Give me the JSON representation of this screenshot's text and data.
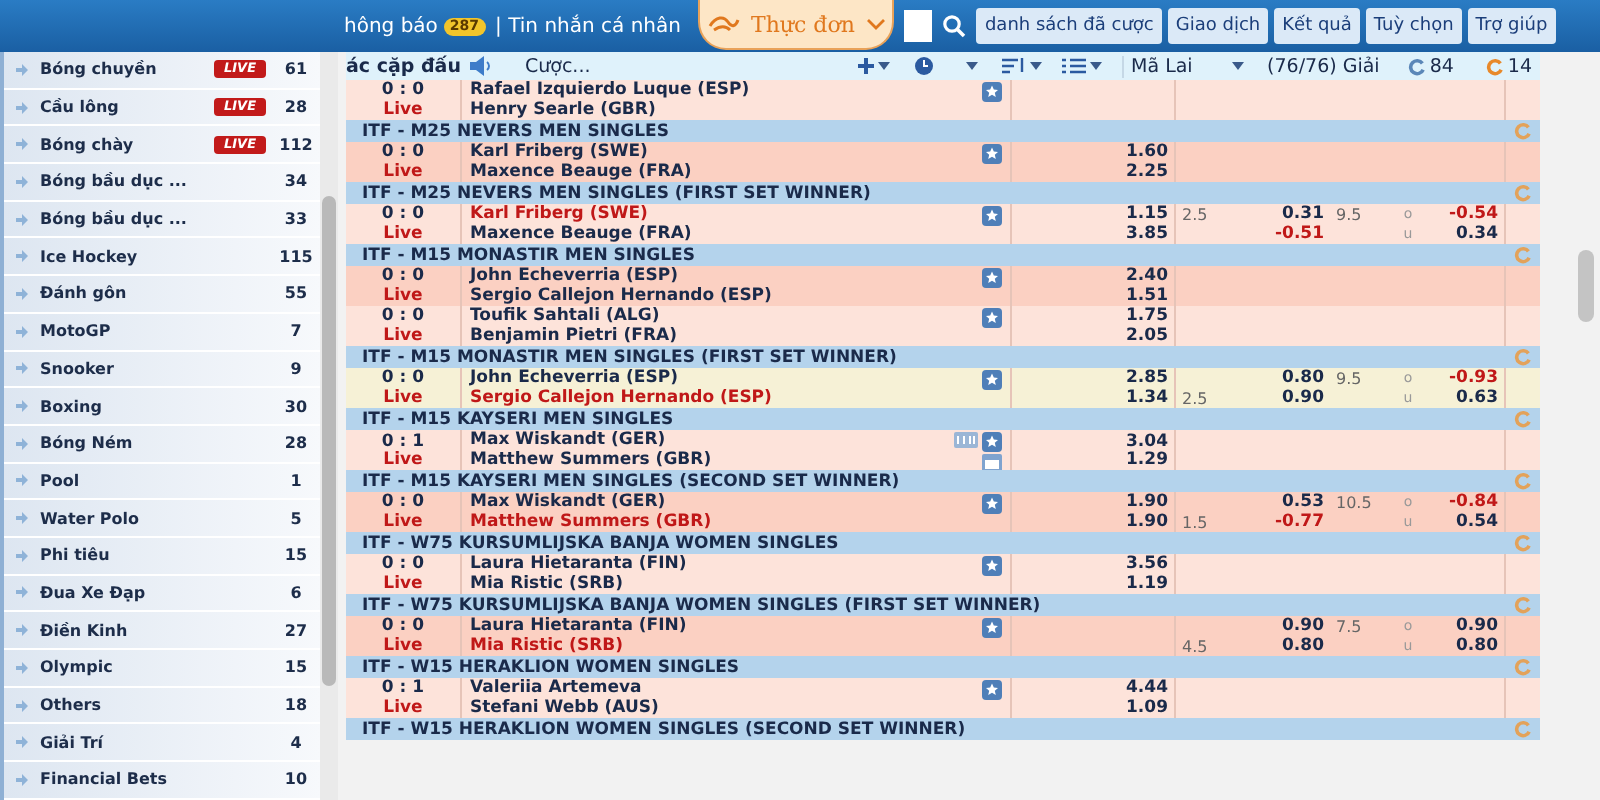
{
  "top_bar": {
    "notice": {
      "label": "hông báo",
      "badge": "287"
    },
    "messages": "| Tin nhắn cá nhân",
    "menu": "Thực đơn",
    "buttons": [
      "danh sách đã cược",
      "Giao dịch",
      "Kết quả",
      "Tuỳ chọn",
      "Trợ giúp"
    ]
  },
  "sidebar": {
    "items": [
      {
        "name": "Bóng chuyền",
        "badge": "LIVE",
        "count": "61"
      },
      {
        "name": "Cầu lông",
        "badge": "LIVE",
        "count": "28"
      },
      {
        "name": "Bóng chày",
        "badge": "LIVE",
        "count": "112"
      },
      {
        "name": "Bóng bầu dục ...",
        "count": "34"
      },
      {
        "name": "Bóng bầu dục ...",
        "count": "33"
      },
      {
        "name": "Ice Hockey",
        "count": "115"
      },
      {
        "name": "Đánh gôn",
        "count": "55"
      },
      {
        "name": "MotoGP",
        "count": "7"
      },
      {
        "name": "Snooker",
        "count": "9"
      },
      {
        "name": "Boxing",
        "count": "30"
      },
      {
        "name": "Bóng Ném",
        "count": "28"
      },
      {
        "name": "Pool",
        "count": "1"
      },
      {
        "name": "Water Polo",
        "count": "5"
      },
      {
        "name": "Phi tiêu",
        "count": "15"
      },
      {
        "name": "Đua Xe Đạp",
        "count": "6"
      },
      {
        "name": "Điền Kinh",
        "count": "27"
      },
      {
        "name": "Olympic",
        "count": "15"
      },
      {
        "name": "Others",
        "count": "18"
      },
      {
        "name": "Giải Trí",
        "count": "4"
      },
      {
        "name": "Financial Bets",
        "count": "10"
      }
    ]
  },
  "toolbar": {
    "title": "ác cặp đấu",
    "bet_select": "Cược...",
    "region_select": "Mã Lai",
    "league_count": "(76/76) Giải",
    "refresh_counts": [
      "84",
      "14"
    ]
  },
  "table": {
    "rows": [
      {
        "kind": "match",
        "color": "#fde3da",
        "score": "0 : 0",
        "status": "Live",
        "has_stats": false,
        "lines": [
          {
            "team": "Rafael Izquierdo Luque (ESP)",
            "highlighted": false
          },
          {
            "team": "Henry Searle (GBR)",
            "highlighted": false
          }
        ]
      },
      {
        "kind": "league",
        "title": "ITF - M25 NEVERS MEN SINGLES"
      },
      {
        "kind": "match",
        "color": "#fbd0c2",
        "score": "0 : 0",
        "status": "Live",
        "has_stats": false,
        "lines": [
          {
            "team": "Karl Friberg (SWE)",
            "highlighted": false,
            "odds": "1.60"
          },
          {
            "team": "Maxence Beauge (FRA)",
            "highlighted": false,
            "odds": "2.25"
          }
        ]
      },
      {
        "kind": "league",
        "title": "ITF - M25 NEVERS MEN SINGLES (FIRST SET WINNER)"
      },
      {
        "kind": "match",
        "color": "#fde3da",
        "score": "0 : 0",
        "status": "Live",
        "has_stats": false,
        "lines": [
          {
            "team": "Karl Friberg (SWE)",
            "highlighted": true,
            "odds": "1.15",
            "hdp": "2.5",
            "hdp_odds": "0.31",
            "ou_line": "9.5",
            "ou_side": "o",
            "ou_odds": "-0.54"
          },
          {
            "team": "Maxence Beauge (FRA)",
            "highlighted": false,
            "odds": "3.85",
            "hdp_odds": "-0.51",
            "ou_side": "u",
            "ou_odds": "0.34"
          }
        ]
      },
      {
        "kind": "league",
        "title": "ITF - M15 MONASTIR MEN SINGLES"
      },
      {
        "kind": "match",
        "color": "#fbd0c2",
        "score": "0 : 0",
        "status": "Live",
        "has_stats": false,
        "lines": [
          {
            "team": "John Echeverria (ESP)",
            "highlighted": false,
            "odds": "2.40"
          },
          {
            "team": "Sergio Callejon Hernando (ESP)",
            "highlighted": false,
            "odds": "1.51"
          }
        ]
      },
      {
        "kind": "match",
        "color": "#fde3da",
        "score": "0 : 0",
        "status": "Live",
        "has_stats": false,
        "lines": [
          {
            "team": "Toufik Sahtali (ALG)",
            "highlighted": false,
            "odds": "1.75"
          },
          {
            "team": "Benjamin Pietri (FRA)",
            "highlighted": false,
            "odds": "2.05"
          }
        ]
      },
      {
        "kind": "league",
        "title": "ITF - M15 MONASTIR MEN SINGLES (FIRST SET WINNER)"
      },
      {
        "kind": "match",
        "color": "#f6f1d6",
        "score": "0 : 0",
        "status": "Live",
        "has_stats": false,
        "lines": [
          {
            "team": "John Echeverria (ESP)",
            "highlighted": false,
            "odds": "2.85",
            "hdp_odds": "0.80",
            "ou_line": "9.5",
            "ou_side": "o",
            "ou_odds": "-0.93"
          },
          {
            "team": "Sergio Callejon Hernando (ESP)",
            "highlighted": true,
            "odds": "1.34",
            "hdp": "2.5",
            "hdp_odds": "0.90",
            "ou_side": "u",
            "ou_odds": "0.63"
          }
        ]
      },
      {
        "kind": "league",
        "title": "ITF - M15 KAYSERI MEN SINGLES"
      },
      {
        "kind": "match",
        "color": "#fde3da",
        "score": "0 : 1",
        "status": "Live",
        "has_stats": true,
        "lines": [
          {
            "team": "Max Wiskandt (GER)",
            "highlighted": false,
            "odds": "3.04"
          },
          {
            "team": "Matthew Summers (GBR)",
            "highlighted": false,
            "odds": "1.29"
          }
        ]
      },
      {
        "kind": "league",
        "title": "ITF - M15 KAYSERI MEN SINGLES (SECOND SET WINNER)"
      },
      {
        "kind": "match",
        "color": "#fbd0c2",
        "score": "0 : 0",
        "status": "Live",
        "has_stats": false,
        "lines": [
          {
            "team": "Max Wiskandt (GER)",
            "highlighted": false,
            "odds": "1.90",
            "hdp_odds": "0.53",
            "ou_line": "10.5",
            "ou_side": "o",
            "ou_odds": "-0.84"
          },
          {
            "team": "Matthew Summers (GBR)",
            "highlighted": true,
            "odds": "1.90",
            "hdp": "1.5",
            "hdp_odds": "-0.77",
            "ou_side": "u",
            "ou_odds": "0.54"
          }
        ]
      },
      {
        "kind": "league",
        "title": "ITF - W75 KURSUMLIJSKA BANJA WOMEN SINGLES"
      },
      {
        "kind": "match",
        "color": "#fde3da",
        "score": "0 : 0",
        "status": "Live",
        "has_stats": false,
        "lines": [
          {
            "team": "Laura Hietaranta (FIN)",
            "highlighted": false,
            "odds": "3.56"
          },
          {
            "team": "Mia Ristic (SRB)",
            "highlighted": false,
            "odds": "1.19"
          }
        ]
      },
      {
        "kind": "league",
        "title": "ITF - W75 KURSUMLIJSKA BANJA WOMEN SINGLES (FIRST SET WINNER)"
      },
      {
        "kind": "match",
        "color": "#fbd0c2",
        "score": "0 : 0",
        "status": "Live",
        "has_stats": false,
        "lines": [
          {
            "team": "Laura Hietaranta (FIN)",
            "highlighted": false,
            "hdp_odds": "0.90",
            "ou_line": "7.5",
            "ou_side": "o",
            "ou_odds": "0.90"
          },
          {
            "team": "Mia Ristic (SRB)",
            "highlighted": true,
            "hdp": "4.5",
            "hdp_odds": "0.80",
            "ou_side": "u",
            "ou_odds": "0.80"
          }
        ]
      },
      {
        "kind": "league",
        "title": "ITF - W15 HERAKLION WOMEN SINGLES"
      },
      {
        "kind": "match",
        "color": "#fde3da",
        "score": "0 : 1",
        "status": "Live",
        "has_stats": false,
        "lines": [
          {
            "team": "Valeriia Artemeva",
            "highlighted": false,
            "odds": "4.44"
          },
          {
            "team": "Stefani Webb (AUS)",
            "highlighted": false,
            "odds": "1.09"
          }
        ]
      },
      {
        "kind": "league",
        "title": "ITF - W15 HERAKLION WOMEN SINGLES (SECOND SET WINNER)"
      }
    ]
  }
}
